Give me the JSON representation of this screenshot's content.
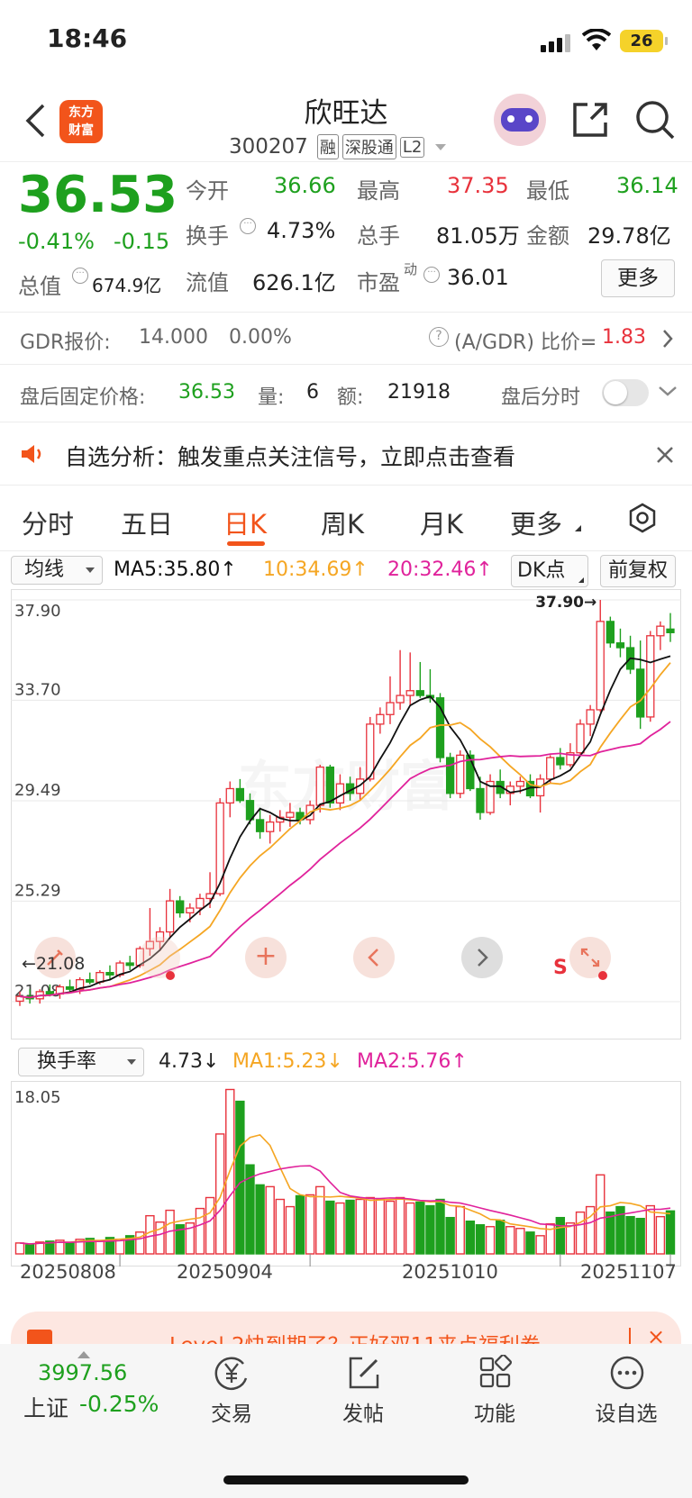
{
  "status_bar": {
    "time": "18:46",
    "battery": "26"
  },
  "header": {
    "back_icon": "chevron-left-icon",
    "logo_line1": "东方",
    "logo_line2": "财富",
    "stock_name": "欣旺达",
    "stock_code": "300207",
    "badges": [
      "融",
      "深股通",
      "L2"
    ]
  },
  "quote": {
    "price": "36.53",
    "change_pct": "-0.41%",
    "change": "-0.15",
    "open_label": "今开",
    "open": "36.66",
    "high_label": "最高",
    "high": "37.35",
    "low_label": "最低",
    "low": "36.14",
    "turnover_label": "换手",
    "turnover": "4.73%",
    "volume_label": "总手",
    "volume": "81.05万",
    "amount_label": "金额",
    "amount": "29.78亿",
    "mktcap_label": "总值",
    "mktcap": "674.9亿",
    "float_label": "流值",
    "float": "626.1亿",
    "pe_label": "市盈",
    "pe_sup": "动",
    "pe": "36.01",
    "more_label": "更多"
  },
  "gdr": {
    "label": "GDR报价:",
    "price": "14.000",
    "pct": "0.00%",
    "ratio_label": "(A/GDR) 比价=",
    "ratio": "1.83"
  },
  "afterhours": {
    "label": "盘后固定价格:",
    "price": "36.53",
    "vol_label": "量:",
    "vol": "6",
    "amt_label": "额:",
    "amt": "21918",
    "toggle_label": "盘后分时"
  },
  "notice": {
    "text": "自选分析：触发重点关注信号，立即点击查看"
  },
  "tabs": [
    "分时",
    "五日",
    "日K",
    "周K",
    "月K",
    "更多"
  ],
  "active_tab": "日K",
  "indicator_bar": {
    "selector": "均线",
    "ma5": "MA5:35.80",
    "ma10": "10:34.69",
    "ma20": "20:32.46",
    "dk_label": "DK点",
    "fq_label": "前复权"
  },
  "price_axis": [
    "37.90",
    "33.70",
    "29.49",
    "25.29",
    "21.08"
  ],
  "high_marker": "37.90",
  "low_marker": "21.08",
  "volume_bar": {
    "selector": "换手率",
    "value": "4.73",
    "ma1": "MA1:5.23",
    "ma2": "MA2:5.76",
    "max_label": "18.05"
  },
  "dates": [
    "20250808",
    "20250904",
    "20251010",
    "20251107"
  ],
  "banner": {
    "text": "Level-2快到期了？正好双11来点福利券"
  },
  "bottom_nav": {
    "index_value": "3997.56",
    "index_name": "上证",
    "index_change": "-0.25%",
    "items": [
      "交易",
      "发帖",
      "功能",
      "设自选"
    ]
  },
  "colors": {
    "up": "#e8323c",
    "down": "#1ea01e",
    "accent": "#f2541b",
    "ma5": "#111111",
    "ma10": "#f5a623",
    "ma20": "#e0229b"
  },
  "chart_data": {
    "type": "candlestick",
    "ylim": [
      21.08,
      37.9
    ],
    "candles": [
      [
        21.1,
        21.5,
        20.9,
        21.3
      ],
      [
        21.3,
        21.6,
        21.0,
        21.2
      ],
      [
        21.2,
        21.6,
        21.0,
        21.5
      ],
      [
        21.5,
        21.8,
        21.3,
        21.4
      ],
      [
        21.4,
        21.8,
        21.2,
        21.7
      ],
      [
        21.7,
        22.0,
        21.5,
        21.6
      ],
      [
        21.6,
        22.1,
        21.4,
        22.0
      ],
      [
        22.0,
        22.3,
        21.8,
        21.9
      ],
      [
        21.9,
        22.4,
        21.8,
        22.3
      ],
      [
        22.3,
        22.6,
        22.0,
        22.2
      ],
      [
        22.2,
        22.8,
        22.1,
        22.7
      ],
      [
        22.7,
        23.0,
        22.4,
        22.6
      ],
      [
        22.6,
        23.4,
        22.5,
        23.3
      ],
      [
        23.3,
        25.0,
        23.0,
        23.6
      ],
      [
        23.6,
        24.2,
        23.2,
        24.0
      ],
      [
        24.0,
        25.8,
        23.8,
        25.3
      ],
      [
        25.3,
        25.5,
        24.6,
        24.8
      ],
      [
        24.8,
        25.2,
        24.4,
        25.0
      ],
      [
        25.0,
        25.6,
        24.7,
        25.4
      ],
      [
        25.4,
        26.5,
        25.0,
        25.6
      ],
      [
        25.6,
        29.6,
        25.5,
        29.4
      ],
      [
        29.4,
        30.3,
        28.8,
        30.0
      ],
      [
        30.0,
        30.4,
        29.4,
        29.5
      ],
      [
        29.5,
        29.8,
        28.5,
        28.7
      ],
      [
        28.7,
        29.2,
        27.9,
        28.2
      ],
      [
        28.2,
        28.9,
        27.7,
        28.6
      ],
      [
        28.6,
        29.1,
        28.2,
        28.8
      ],
      [
        28.8,
        29.4,
        28.4,
        29.0
      ],
      [
        29.0,
        29.2,
        28.5,
        28.7
      ],
      [
        28.7,
        29.5,
        28.5,
        29.3
      ],
      [
        29.3,
        31.0,
        29.0,
        30.9
      ],
      [
        30.9,
        31.0,
        29.2,
        29.4
      ],
      [
        29.4,
        30.6,
        29.1,
        30.2
      ],
      [
        30.2,
        30.5,
        29.5,
        29.8
      ],
      [
        29.8,
        30.9,
        29.5,
        30.4
      ],
      [
        30.4,
        33.0,
        30.3,
        32.7
      ],
      [
        32.7,
        33.4,
        32.3,
        33.1
      ],
      [
        33.1,
        34.7,
        32.7,
        33.6
      ],
      [
        33.6,
        35.8,
        33.3,
        33.9
      ],
      [
        33.9,
        35.7,
        33.5,
        34.1
      ],
      [
        34.1,
        35.3,
        33.8,
        33.9
      ],
      [
        33.9,
        35.0,
        33.6,
        33.8
      ],
      [
        33.8,
        34.0,
        31.1,
        31.3
      ],
      [
        31.3,
        31.5,
        29.6,
        29.8
      ],
      [
        29.8,
        31.6,
        29.6,
        31.4
      ],
      [
        31.4,
        31.6,
        29.9,
        30.0
      ],
      [
        30.0,
        30.5,
        28.7,
        29.0
      ],
      [
        29.0,
        30.6,
        28.9,
        30.3
      ],
      [
        30.3,
        30.8,
        29.6,
        29.8
      ],
      [
        29.8,
        30.3,
        29.3,
        30.1
      ],
      [
        30.1,
        30.5,
        29.8,
        30.3
      ],
      [
        30.3,
        30.6,
        29.6,
        29.7
      ],
      [
        29.7,
        30.6,
        29.0,
        30.4
      ],
      [
        30.4,
        31.4,
        30.2,
        31.3
      ],
      [
        31.3,
        31.7,
        30.8,
        31.0
      ],
      [
        31.0,
        31.9,
        30.9,
        31.5
      ],
      [
        31.5,
        32.9,
        31.4,
        32.7
      ],
      [
        32.7,
        33.5,
        32.2,
        33.3
      ],
      [
        33.3,
        37.9,
        33.2,
        37.0
      ],
      [
        37.0,
        37.2,
        35.9,
        36.1
      ],
      [
        36.1,
        36.7,
        35.5,
        35.9
      ],
      [
        35.9,
        36.4,
        34.8,
        35.0
      ],
      [
        35.0,
        36.2,
        32.5,
        33.0
      ],
      [
        33.0,
        36.6,
        32.8,
        36.4
      ],
      [
        36.4,
        37.0,
        35.8,
        36.8
      ],
      [
        36.68,
        37.35,
        36.14,
        36.53
      ]
    ],
    "volume_ratio": [
      1.2,
      1.0,
      1.3,
      1.4,
      1.5,
      1.2,
      1.6,
      1.7,
      1.4,
      1.8,
      1.6,
      2.0,
      2.4,
      4.2,
      3.5,
      4.8,
      3.2,
      3.4,
      5.0,
      6.2,
      13.2,
      18.1,
      16.8,
      9.8,
      7.6,
      7.4,
      6.0,
      5.2,
      6.4,
      6.5,
      7.4,
      5.8,
      5.6,
      5.9,
      6.0,
      6.2,
      6.0,
      5.8,
      6.2,
      5.6,
      5.7,
      5.3,
      6.0,
      4.0,
      5.2,
      3.6,
      3.2,
      3.0,
      3.7,
      3.0,
      2.8,
      2.4,
      2.0,
      3.3,
      4.0,
      3.4,
      4.6,
      5.2,
      8.7,
      4.6,
      5.2,
      4.1,
      3.9,
      5.3,
      4.1,
      4.73
    ],
    "volume_ylim": [
      0,
      18.05
    ],
    "x_labels": [
      "20250808",
      "20250904",
      "20251010",
      "20251107"
    ]
  }
}
